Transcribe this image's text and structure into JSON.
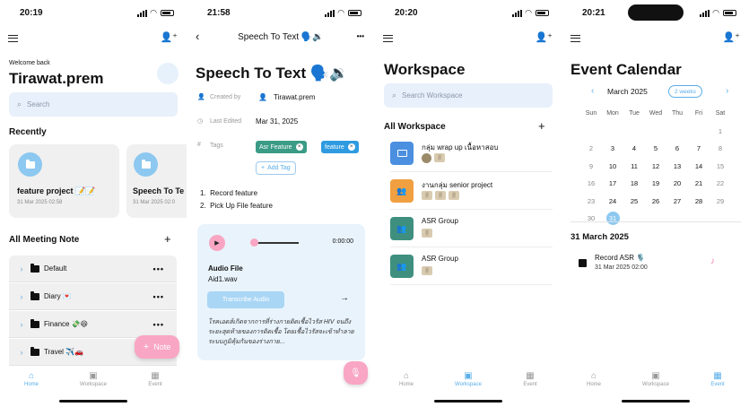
{
  "screens": [
    {
      "status_time": "20:19",
      "welcome": "Welcome back",
      "username": "Tirawat.prem",
      "search_placeholder": "Search",
      "recently_title": "Recently",
      "recent_cards": [
        {
          "title": "feature project 📝📝",
          "date": "31 Mar 2025 02:58"
        },
        {
          "title": "Speech To Te",
          "date": "31 Mar 2025 02:0"
        }
      ],
      "all_notes_title": "All Meeting Note",
      "add_symbol": "+",
      "folders": [
        {
          "name": "Default"
        },
        {
          "name": "Diary 💌"
        },
        {
          "name": "Finance 💸😆"
        },
        {
          "name": "Travel ✈️🚗"
        }
      ],
      "more_symbol": "•••",
      "fab_label": "Note",
      "tabs": [
        {
          "label": "Home"
        },
        {
          "label": "Workspace"
        },
        {
          "label": "Event"
        }
      ]
    },
    {
      "status_time": "21:58",
      "header_title": "Speech To Text 🗣️🔉",
      "title": "Speech To Text 🗣️🔉",
      "created_by_label": "Created by",
      "created_by_value": "Tirawat.prem",
      "last_edited_label": "Last Edited",
      "last_edited_value": "Mar 31, 2025",
      "tags_label": "Tags",
      "tags": [
        {
          "label": "Asr Feature",
          "color": "#3a9b86"
        },
        {
          "label": "feature",
          "color": "#2e9be0"
        }
      ],
      "add_tag": "Add Tag",
      "list_items": [
        "Record feature",
        "Pick Up File feature"
      ],
      "audio_time": "0:00:00",
      "audio_file_label": "Audio File",
      "audio_file_name": "Aid1.wav",
      "transcribe_label": "Transcribe Audio",
      "transcript": "โรคเอดส์เกิดจากการที่ร่างกายติดเชื้อไวรัส HIV จนถึงระยะสุดท้ายของการติดเชื้อ โดยเชื้อไวรัสจะเข้าทำลายระบบภูมิคุ้มกันของร่างกาย..."
    },
    {
      "status_time": "20:20",
      "title": "Workspace",
      "search_placeholder": "Search Workspace",
      "section_title": "All Workspace",
      "add_symbol": "+",
      "workspaces": [
        {
          "name": "กลุ่ม wrap up เนื้อหาสอบ",
          "color": "#4b8fe0",
          "icon": "book-icon"
        },
        {
          "name": "งานกลุ่ม senior project",
          "color": "#f0a040",
          "icon": "group-icon"
        },
        {
          "name": "ASR Group",
          "color": "#3f8f7f",
          "icon": "group-icon"
        },
        {
          "name": "ASR Group",
          "color": "#3f8f7f",
          "icon": "group-icon"
        }
      ],
      "tabs": [
        {
          "label": "Home"
        },
        {
          "label": "Workspace"
        },
        {
          "label": "Event"
        }
      ]
    },
    {
      "status_time": "20:21",
      "title": "Event Calendar",
      "month": "March 2025",
      "view_toggle": "2 weeks",
      "weekdays": [
        "Sun",
        "Mon",
        "Tue",
        "Wed",
        "Thu",
        "Fri",
        "Sat"
      ],
      "weeks": [
        [
          "",
          "",
          "",
          "",
          "",
          "",
          "1"
        ],
        [
          "2",
          "3",
          "4",
          "5",
          "6",
          "7",
          "8"
        ],
        [
          "9",
          "10",
          "11",
          "12",
          "13",
          "14",
          "15"
        ],
        [
          "16",
          "17",
          "18",
          "19",
          "20",
          "21",
          "22"
        ],
        [
          "23",
          "24",
          "25",
          "26",
          "27",
          "28",
          "29"
        ],
        [
          "30",
          "31",
          "",
          "",
          "",
          "",
          ""
        ]
      ],
      "selected_day": "31",
      "selected_date_title": "31 March 2025",
      "event_title": "Record ASR 🎙️",
      "event_time": "31 Mar 2025 02:00",
      "tabs": [
        {
          "label": "Home"
        },
        {
          "label": "Workspace"
        },
        {
          "label": "Event"
        }
      ]
    }
  ],
  "colors": {
    "accent_blue": "#5aaee8",
    "pink_fab": "#f8a6c3",
    "search_bg": "#e8f0fb"
  }
}
